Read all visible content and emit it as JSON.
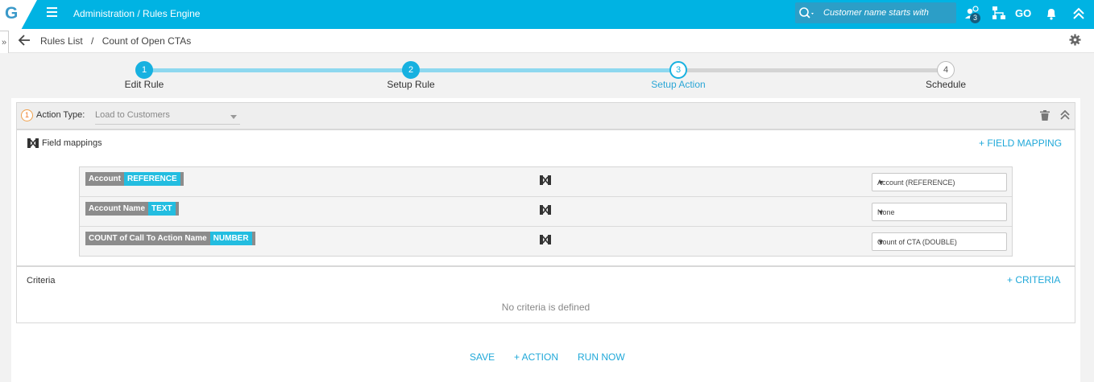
{
  "header": {
    "logo": "G",
    "breadcrumb": "Administration / Rules Engine",
    "search_placeholder": "Customer name starts with",
    "notification_count": "3",
    "go_label": "GO"
  },
  "subheader": {
    "expand": "»",
    "breadcrumb_root": "Rules List",
    "separator": "/",
    "breadcrumb_current": "Count of Open CTAs"
  },
  "stepper": {
    "steps": [
      {
        "number": "1",
        "label": "Edit Rule",
        "state": "done"
      },
      {
        "number": "2",
        "label": "Setup Rule",
        "state": "done"
      },
      {
        "number": "3",
        "label": "Setup Action",
        "state": "current"
      },
      {
        "number": "4",
        "label": "Schedule",
        "state": "pending"
      }
    ],
    "colors": {
      "active": "#29b8e3",
      "inactive": "#d0d0d0"
    }
  },
  "action": {
    "number": "1",
    "type_label": "Action Type:",
    "type_value": "Load to Customers"
  },
  "field_mappings": {
    "title": "Field mappings",
    "add_label": "+ FIELD MAPPING",
    "rows": [
      {
        "source": "Account",
        "source_type": "REFERENCE",
        "target": "Account (REFERENCE)"
      },
      {
        "source": "Account Name",
        "source_type": "TEXT",
        "target": "None"
      },
      {
        "source": "COUNT of Call To Action Name",
        "source_type": "NUMBER",
        "target": "Count of CTA (DOUBLE)"
      }
    ]
  },
  "criteria": {
    "title": "Criteria",
    "add_label": "+ CRITERIA",
    "empty_text": "No criteria is defined"
  },
  "footer": {
    "save": "SAVE",
    "add_action": "+ ACTION",
    "run_now": "RUN NOW"
  }
}
